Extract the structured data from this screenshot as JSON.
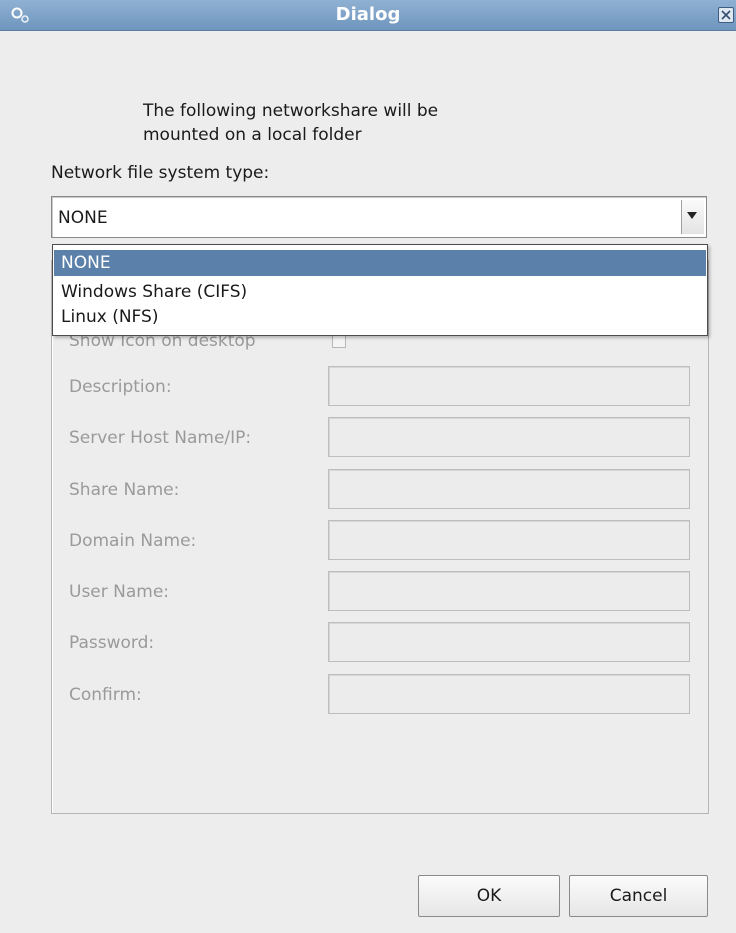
{
  "window": {
    "title": "Dialog",
    "app_icon": "gears-icon",
    "close_icon": "close-icon"
  },
  "intro_text": [
    "The following networkshare will be",
    "mounted on a local folder"
  ],
  "fs_type": {
    "label": "Network file system type:",
    "selected": "NONE",
    "options": [
      "NONE",
      "Windows Share (CIFS)",
      "Linux (NFS)"
    ]
  },
  "form": {
    "show_icon_label": "Show Icon on desktop",
    "show_icon_checked": false,
    "fields": [
      {
        "label": "Description:",
        "value": ""
      },
      {
        "label": "Server Host Name/IP:",
        "value": ""
      },
      {
        "label": "Share Name:",
        "value": ""
      },
      {
        "label": "Domain Name:",
        "value": ""
      },
      {
        "label": "User Name:",
        "value": ""
      },
      {
        "label": "Password:",
        "value": ""
      },
      {
        "label": "Confirm:",
        "value": ""
      }
    ]
  },
  "buttons": {
    "ok": "OK",
    "cancel": "Cancel"
  },
  "colors": {
    "titlebar": "#7a9fc6",
    "selection": "#5b81aa",
    "disabled_text": "#9a9a9a"
  }
}
